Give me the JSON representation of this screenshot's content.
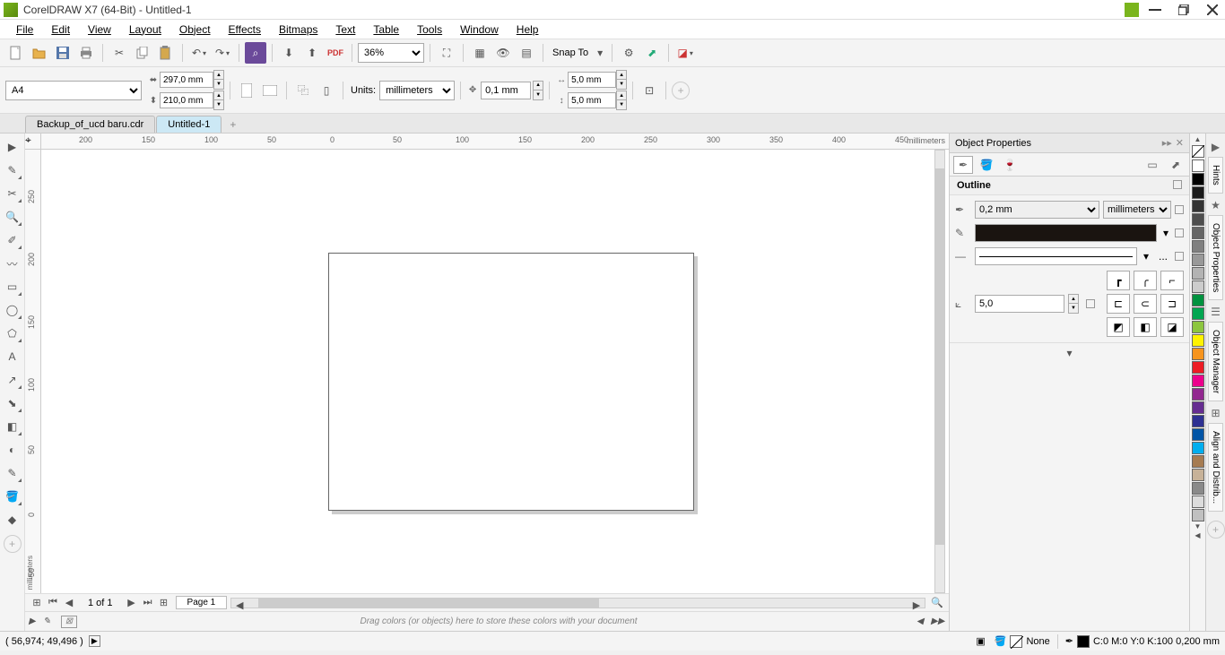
{
  "app": {
    "title": "CorelDRAW X7 (64-Bit) - Untitled-1"
  },
  "menu": [
    "File",
    "Edit",
    "View",
    "Layout",
    "Object",
    "Effects",
    "Bitmaps",
    "Text",
    "Table",
    "Tools",
    "Window",
    "Help"
  ],
  "toolbar1": {
    "zoom": "36%",
    "snap_label": "Snap To"
  },
  "propbar": {
    "page_size": "A4",
    "width": "297,0 mm",
    "height": "210,0 mm",
    "units_label": "Units:",
    "units": "millimeters",
    "nudge": "0,1 mm",
    "dup_x": "5,0 mm",
    "dup_y": "5,0 mm"
  },
  "doc_tabs": [
    "Backup_of_ucd baru.cdr",
    "Untitled-1"
  ],
  "ruler_h": [
    "200",
    "150",
    "100",
    "50",
    "0",
    "50",
    "100",
    "150",
    "200",
    "250",
    "300",
    "350",
    "400",
    "450"
  ],
  "ruler_h_unit": "millimeters",
  "ruler_v": [
    "250",
    "200",
    "150",
    "100",
    "50",
    "0",
    "-50"
  ],
  "ruler_v_unit": "millimeters",
  "page_nav": {
    "indicator": "1 of 1",
    "page_tab": "Page 1"
  },
  "color_dock_hint": "Drag colors (or objects) here to store these colors with your document",
  "panel": {
    "title": "Object Properties",
    "section": "Outline",
    "width": "0,2 mm",
    "units": "millimeters",
    "miter": "5,0",
    "more": "..."
  },
  "docker_tabs": [
    "Hints",
    "Object Properties",
    "Object Manager",
    "Align and Distrib..."
  ],
  "palette": [
    "#ffffff",
    "#000000",
    "#1a1a1a",
    "#333333",
    "#4d4d4d",
    "#666666",
    "#808080",
    "#999999",
    "#b3b3b3",
    "#cccccc",
    "#00923f",
    "#00a651",
    "#8dc63f",
    "#fff200",
    "#f7941d",
    "#ed1c24",
    "#ec008c",
    "#92278f",
    "#662d91",
    "#2e3192",
    "#0054a6",
    "#00aeef",
    "#a67c52",
    "#c7b299",
    "#8a8a8a",
    "#dcdcdc",
    "#c0c0c0"
  ],
  "status": {
    "cursor": "( 56,974; 49,496 )",
    "fill": "None",
    "outline_info": "C:0 M:0 Y:0 K:100  0,200 mm"
  }
}
